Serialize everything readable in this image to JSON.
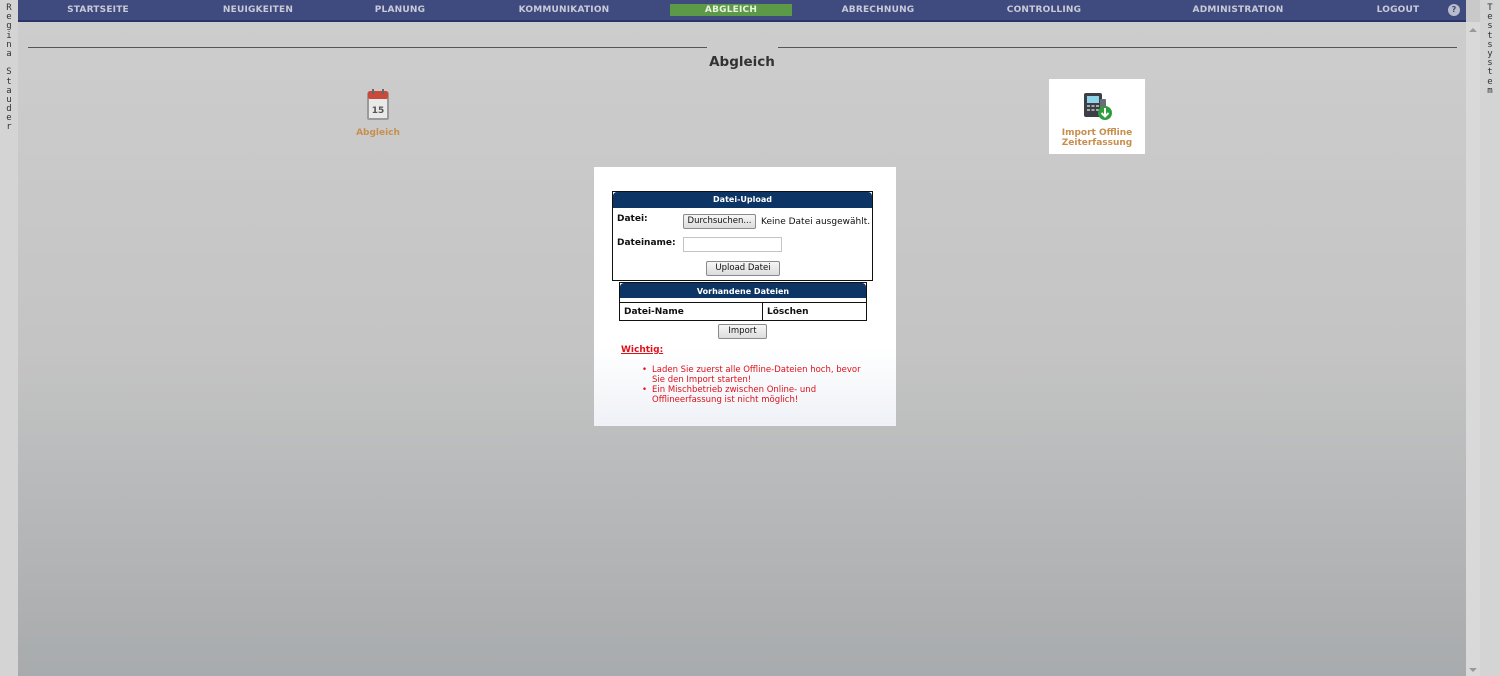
{
  "side_left": {
    "letters": [
      "R",
      "e",
      "g",
      "i",
      "n",
      "a",
      " ",
      "S",
      "t",
      "a",
      "u",
      "d",
      "e",
      "r"
    ]
  },
  "side_right": {
    "letters": [
      "T",
      "e",
      "s",
      "t",
      "s",
      "y",
      "s",
      "t",
      "e",
      "m"
    ]
  },
  "nav": {
    "items": [
      {
        "label": "STARTSEITE"
      },
      {
        "label": "NEUIGKEITEN"
      },
      {
        "label": "PLANUNG"
      },
      {
        "label": "KOMMUNIKATION"
      },
      {
        "label": "ABGLEICH",
        "active": true
      },
      {
        "label": "ABRECHNUNG"
      },
      {
        "label": "CONTROLLING"
      },
      {
        "label": "ADMINISTRATION"
      },
      {
        "label": "LOGOUT"
      }
    ],
    "help_icon": "help-icon"
  },
  "page": {
    "title": "Abgleich"
  },
  "tiles": {
    "abgleich": {
      "label": "Abgleich",
      "icon": "calendar-icon"
    },
    "import": {
      "label_line1": "Import Offline",
      "label_line2": "Zeiterfassung",
      "icon": "terminal-download-icon"
    }
  },
  "upload": {
    "header": "Datei-Upload",
    "file_label": "Datei:",
    "browse_button": "Durchsuchen...",
    "no_file_text": "Keine Datei ausgewählt.",
    "filename_label": "Dateiname:",
    "filename_value": "",
    "upload_button": "Upload Datei"
  },
  "files": {
    "header": "Vorhandene Dateien",
    "columns": [
      "Datei-Name",
      "Löschen"
    ],
    "rows": []
  },
  "import_button": "Import",
  "notice": {
    "title": "Wichtig:",
    "items": [
      "Laden Sie zuerst alle Offline-Dateien hoch, bevor Sie den Import starten!",
      "Ein Mischbetrieb zwischen Online- und Offlineerfassung ist nicht möglich!"
    ]
  },
  "colors": {
    "nav_bg": "#3f4a7f",
    "nav_active": "#5d9a48",
    "box_header": "#0c3464",
    "warning": "#e0101a",
    "tile_label": "#c68f4e"
  }
}
